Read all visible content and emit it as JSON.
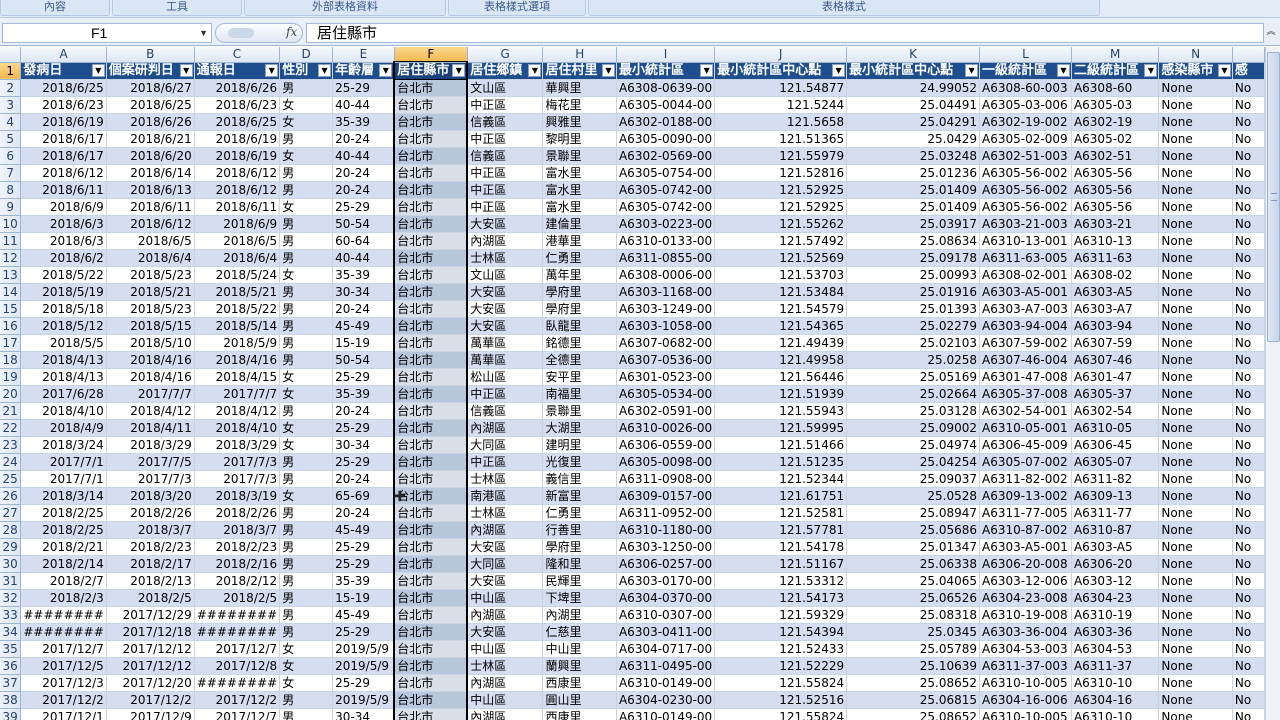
{
  "ribbon": {
    "groups": [
      "內容",
      "工具",
      "外部表格資料",
      "表格樣式選項",
      "表格樣式"
    ]
  },
  "formula_bar": {
    "name_box": "F1",
    "fx_label": "fx",
    "content": "居住縣市"
  },
  "columns": [
    "A",
    "B",
    "C",
    "D",
    "E",
    "F",
    "G",
    "H",
    "I",
    "J",
    "K",
    "L",
    "M",
    "N",
    ""
  ],
  "selected_column": "F",
  "headers": [
    "發病日",
    "個案研判日",
    "通報日",
    "性別",
    "年齡層",
    "居住縣市",
    "居住鄉鎮",
    "居住村里",
    "最小統計區",
    "最小統計區中心點",
    "最小統計區中心點",
    "一級統計區",
    "二級統計區",
    "感染縣市",
    "感"
  ],
  "rows": [
    [
      "2",
      "2018/6/25",
      "2018/6/27",
      "2018/6/26",
      "男",
      "25-29",
      "台北市",
      "文山區",
      "華興里",
      "A6308-0639-00",
      "121.54877",
      "24.99052",
      "A6308-60-003",
      "A6308-60",
      "None",
      "No"
    ],
    [
      "3",
      "2018/6/23",
      "2018/6/25",
      "2018/6/23",
      "女",
      "40-44",
      "台北市",
      "中正區",
      "梅花里",
      "A6305-0044-00",
      "121.5244",
      "25.04491",
      "A6305-03-006",
      "A6305-03",
      "None",
      "No"
    ],
    [
      "4",
      "2018/6/19",
      "2018/6/26",
      "2018/6/25",
      "女",
      "35-39",
      "台北市",
      "信義區",
      "興雅里",
      "A6302-0188-00",
      "121.5658",
      "25.04291",
      "A6302-19-002",
      "A6302-19",
      "None",
      "No"
    ],
    [
      "5",
      "2018/6/17",
      "2018/6/21",
      "2018/6/19",
      "男",
      "20-24",
      "台北市",
      "中正區",
      "黎明里",
      "A6305-0090-00",
      "121.51365",
      "25.0429",
      "A6305-02-009",
      "A6305-02",
      "None",
      "No"
    ],
    [
      "6",
      "2018/6/17",
      "2018/6/20",
      "2018/6/19",
      "女",
      "40-44",
      "台北市",
      "信義區",
      "景聯里",
      "A6302-0569-00",
      "121.55979",
      "25.03248",
      "A6302-51-003",
      "A6302-51",
      "None",
      "No"
    ],
    [
      "7",
      "2018/6/12",
      "2018/6/14",
      "2018/6/12",
      "男",
      "20-24",
      "台北市",
      "中正區",
      "富水里",
      "A6305-0754-00",
      "121.52816",
      "25.01236",
      "A6305-56-002",
      "A6305-56",
      "None",
      "No"
    ],
    [
      "8",
      "2018/6/11",
      "2018/6/13",
      "2018/6/12",
      "男",
      "20-24",
      "台北市",
      "中正區",
      "富水里",
      "A6305-0742-00",
      "121.52925",
      "25.01409",
      "A6305-56-002",
      "A6305-56",
      "None",
      "No"
    ],
    [
      "9",
      "2018/6/9",
      "2018/6/11",
      "2018/6/11",
      "女",
      "25-29",
      "台北市",
      "中正區",
      "富水里",
      "A6305-0742-00",
      "121.52925",
      "25.01409",
      "A6305-56-002",
      "A6305-56",
      "None",
      "No"
    ],
    [
      "10",
      "2018/6/3",
      "2018/6/12",
      "2018/6/9",
      "男",
      "50-54",
      "台北市",
      "大安區",
      "建倫里",
      "A6303-0223-00",
      "121.55262",
      "25.03917",
      "A6303-21-003",
      "A6303-21",
      "None",
      "No"
    ],
    [
      "11",
      "2018/6/3",
      "2018/6/5",
      "2018/6/5",
      "男",
      "60-64",
      "台北市",
      "內湖區",
      "港華里",
      "A6310-0133-00",
      "121.57492",
      "25.08634",
      "A6310-13-001",
      "A6310-13",
      "None",
      "No"
    ],
    [
      "12",
      "2018/6/2",
      "2018/6/4",
      "2018/6/4",
      "男",
      "40-44",
      "台北市",
      "士林區",
      "仁勇里",
      "A6311-0855-00",
      "121.52569",
      "25.09178",
      "A6311-63-005",
      "A6311-63",
      "None",
      "No"
    ],
    [
      "13",
      "2018/5/22",
      "2018/5/23",
      "2018/5/24",
      "女",
      "35-39",
      "台北市",
      "文山區",
      "萬年里",
      "A6308-0006-00",
      "121.53703",
      "25.00993",
      "A6308-02-001",
      "A6308-02",
      "None",
      "No"
    ],
    [
      "14",
      "2018/5/19",
      "2018/5/21",
      "2018/5/21",
      "男",
      "30-34",
      "台北市",
      "大安區",
      "學府里",
      "A6303-1168-00",
      "121.53484",
      "25.01916",
      "A6303-A5-001",
      "A6303-A5",
      "None",
      "No"
    ],
    [
      "15",
      "2018/5/18",
      "2018/5/23",
      "2018/5/22",
      "男",
      "20-24",
      "台北市",
      "大安區",
      "學府里",
      "A6303-1249-00",
      "121.54579",
      "25.01393",
      "A6303-A7-003",
      "A6303-A7",
      "None",
      "No"
    ],
    [
      "16",
      "2018/5/12",
      "2018/5/15",
      "2018/5/14",
      "男",
      "45-49",
      "台北市",
      "大安區",
      "臥龍里",
      "A6303-1058-00",
      "121.54365",
      "25.02279",
      "A6303-94-004",
      "A6303-94",
      "None",
      "No"
    ],
    [
      "17",
      "2018/5/5",
      "2018/5/10",
      "2018/5/9",
      "男",
      "15-19",
      "台北市",
      "萬華區",
      "銘德里",
      "A6307-0682-00",
      "121.49439",
      "25.02103",
      "A6307-59-002",
      "A6307-59",
      "None",
      "No"
    ],
    [
      "18",
      "2018/4/13",
      "2018/4/16",
      "2018/4/16",
      "男",
      "50-54",
      "台北市",
      "萬華區",
      "全德里",
      "A6307-0536-00",
      "121.49958",
      "25.0258",
      "A6307-46-004",
      "A6307-46",
      "None",
      "No"
    ],
    [
      "19",
      "2018/4/13",
      "2018/4/16",
      "2018/4/15",
      "女",
      "25-29",
      "台北市",
      "松山區",
      "安平里",
      "A6301-0523-00",
      "121.56446",
      "25.05169",
      "A6301-47-008",
      "A6301-47",
      "None",
      "No"
    ],
    [
      "20",
      "2017/6/28",
      "2017/7/7",
      "2017/7/7",
      "女",
      "35-39",
      "台北市",
      "中正區",
      "南福里",
      "A6305-0534-00",
      "121.51939",
      "25.02664",
      "A6305-37-008",
      "A6305-37",
      "None",
      "No"
    ],
    [
      "21",
      "2018/4/10",
      "2018/4/12",
      "2018/4/12",
      "男",
      "20-24",
      "台北市",
      "信義區",
      "景聯里",
      "A6302-0591-00",
      "121.55943",
      "25.03128",
      "A6302-54-001",
      "A6302-54",
      "None",
      "No"
    ],
    [
      "22",
      "2018/4/9",
      "2018/4/11",
      "2018/4/10",
      "女",
      "25-29",
      "台北市",
      "內湖區",
      "大湖里",
      "A6310-0026-00",
      "121.59995",
      "25.09002",
      "A6310-05-001",
      "A6310-05",
      "None",
      "No"
    ],
    [
      "23",
      "2018/3/24",
      "2018/3/29",
      "2018/3/29",
      "女",
      "30-34",
      "台北市",
      "大同區",
      "建明里",
      "A6306-0559-00",
      "121.51466",
      "25.04974",
      "A6306-45-009",
      "A6306-45",
      "None",
      "No"
    ],
    [
      "24",
      "2017/7/1",
      "2017/7/5",
      "2017/7/3",
      "男",
      "25-29",
      "台北市",
      "中正區",
      "光復里",
      "A6305-0098-00",
      "121.51235",
      "25.04254",
      "A6305-07-002",
      "A6305-07",
      "None",
      "No"
    ],
    [
      "25",
      "2017/7/1",
      "2017/7/3",
      "2017/7/3",
      "男",
      "20-24",
      "台北市",
      "士林區",
      "義信里",
      "A6311-0908-00",
      "121.52344",
      "25.09037",
      "A6311-82-002",
      "A6311-82",
      "None",
      "No"
    ],
    [
      "26",
      "2018/3/14",
      "2018/3/20",
      "2018/3/19",
      "女",
      "65-69",
      "台北市",
      "南港區",
      "新富里",
      "A6309-0157-00",
      "121.61751",
      "25.0528",
      "A6309-13-002",
      "A6309-13",
      "None",
      "No"
    ],
    [
      "27",
      "2018/2/25",
      "2018/2/26",
      "2018/2/26",
      "男",
      "20-24",
      "台北市",
      "士林區",
      "仁勇里",
      "A6311-0952-00",
      "121.52581",
      "25.08947",
      "A6311-77-005",
      "A6311-77",
      "None",
      "No"
    ],
    [
      "28",
      "2018/2/25",
      "2018/3/7",
      "2018/3/7",
      "男",
      "45-49",
      "台北市",
      "內湖區",
      "行善里",
      "A6310-1180-00",
      "121.57781",
      "25.05686",
      "A6310-87-002",
      "A6310-87",
      "None",
      "No"
    ],
    [
      "29",
      "2018/2/21",
      "2018/2/23",
      "2018/2/23",
      "男",
      "25-29",
      "台北市",
      "大安區",
      "學府里",
      "A6303-1250-00",
      "121.54178",
      "25.01347",
      "A6303-A5-001",
      "A6303-A5",
      "None",
      "No"
    ],
    [
      "30",
      "2018/2/14",
      "2018/2/17",
      "2018/2/16",
      "男",
      "25-29",
      "台北市",
      "大同區",
      "隆和里",
      "A6306-0257-00",
      "121.51167",
      "25.06338",
      "A6306-20-008",
      "A6306-20",
      "None",
      "No"
    ],
    [
      "31",
      "2018/2/7",
      "2018/2/13",
      "2018/2/12",
      "男",
      "35-39",
      "台北市",
      "大安區",
      "民輝里",
      "A6303-0170-00",
      "121.53312",
      "25.04065",
      "A6303-12-006",
      "A6303-12",
      "None",
      "No"
    ],
    [
      "32",
      "2018/2/3",
      "2018/2/5",
      "2018/2/5",
      "男",
      "15-19",
      "台北市",
      "中山區",
      "下埤里",
      "A6304-0370-00",
      "121.54173",
      "25.06526",
      "A6304-23-008",
      "A6304-23",
      "None",
      "No"
    ],
    [
      "33",
      "########",
      "2017/12/29",
      "########",
      "男",
      "45-49",
      "台北市",
      "內湖區",
      "內湖里",
      "A6310-0307-00",
      "121.59329",
      "25.08318",
      "A6310-19-008",
      "A6310-19",
      "None",
      "No"
    ],
    [
      "34",
      "########",
      "2017/12/18",
      "########",
      "男",
      "25-29",
      "台北市",
      "大安區",
      "仁慈里",
      "A6303-0411-00",
      "121.54394",
      "25.0345",
      "A6303-36-004",
      "A6303-36",
      "None",
      "No"
    ],
    [
      "35",
      "2017/12/7",
      "2017/12/12",
      "2017/12/7",
      "女",
      "2019/5/9",
      "台北市",
      "中山區",
      "中山里",
      "A6304-0717-00",
      "121.52433",
      "25.05789",
      "A6304-53-003",
      "A6304-53",
      "None",
      "No"
    ],
    [
      "36",
      "2017/12/5",
      "2017/12/12",
      "2017/12/8",
      "女",
      "2019/5/9",
      "台北市",
      "士林區",
      "蘭興里",
      "A6311-0495-00",
      "121.52229",
      "25.10639",
      "A6311-37-003",
      "A6311-37",
      "None",
      "No"
    ],
    [
      "37",
      "2017/12/3",
      "2017/12/20",
      "########",
      "女",
      "25-29",
      "台北市",
      "內湖區",
      "西康里",
      "A6310-0149-00",
      "121.55824",
      "25.08652",
      "A6310-10-005",
      "A6310-10",
      "None",
      "No"
    ],
    [
      "38",
      "2017/12/2",
      "2017/12/2",
      "2017/12/2",
      "男",
      "2019/5/9",
      "台北市",
      "中山區",
      "圓山里",
      "A6304-0230-00",
      "121.52516",
      "25.06815",
      "A6304-16-006",
      "A6304-16",
      "None",
      "No"
    ],
    [
      "39",
      "2017/12/1",
      "2017/12/9",
      "2017/12/7",
      "男",
      "30-34",
      "台北市",
      "內湖區",
      "西康里",
      "A6310-0149-00",
      "121.55824",
      "25.08652",
      "A6310-10-005",
      "A6310-10",
      "None",
      "No"
    ]
  ]
}
